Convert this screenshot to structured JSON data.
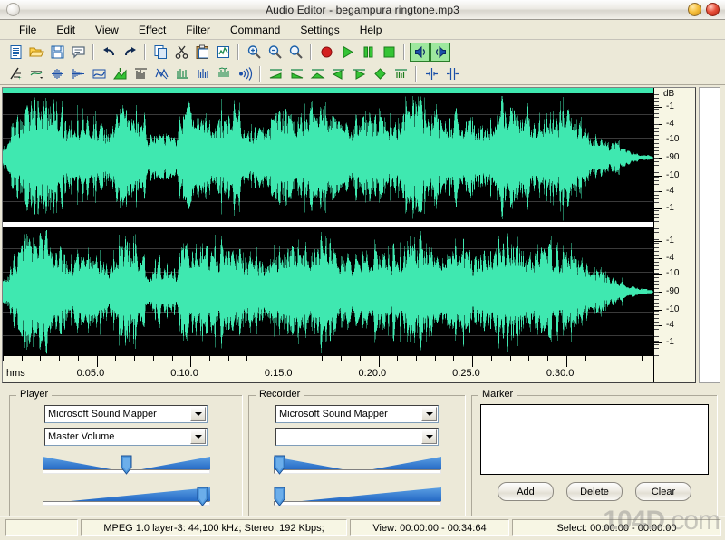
{
  "window": {
    "title": "Audio Editor - begampura ringtone.mp3",
    "buttons": {
      "minimize": "minimize-button",
      "close": "close-button"
    }
  },
  "menu": {
    "items": [
      "File",
      "Edit",
      "View",
      "Effect",
      "Filter",
      "Command",
      "Settings",
      "Help"
    ]
  },
  "toolbar": {
    "row1": [
      {
        "name": "new-file-icon",
        "title": "New"
      },
      {
        "name": "open-file-icon",
        "title": "Open"
      },
      {
        "name": "save-file-icon",
        "title": "Save"
      },
      {
        "name": "comment-icon",
        "title": "Properties"
      },
      {
        "sep": true
      },
      {
        "name": "undo-icon",
        "title": "Undo"
      },
      {
        "name": "redo-icon",
        "title": "Redo"
      },
      {
        "sep": true
      },
      {
        "name": "copy-icon",
        "title": "Copy"
      },
      {
        "name": "cut-icon",
        "title": "Cut"
      },
      {
        "name": "paste-icon",
        "title": "Paste"
      },
      {
        "name": "paste-special-icon",
        "title": "Paste Special"
      },
      {
        "sep": true
      },
      {
        "name": "zoom-in-icon",
        "title": "Zoom In"
      },
      {
        "name": "zoom-out-icon",
        "title": "Zoom Out"
      },
      {
        "name": "zoom-selection-icon",
        "title": "Zoom Selection"
      },
      {
        "sep": true
      },
      {
        "name": "record-icon",
        "title": "Record"
      },
      {
        "name": "play-icon",
        "title": "Play"
      },
      {
        "name": "pause-icon",
        "title": "Pause"
      },
      {
        "name": "stop-icon",
        "title": "Stop"
      },
      {
        "sep": true
      },
      {
        "name": "left-channel-icon",
        "title": "Left Channel"
      },
      {
        "name": "right-channel-icon",
        "title": "Right Channel"
      }
    ],
    "row2": [
      {
        "name": "amplify-icon",
        "title": "Amplify"
      },
      {
        "name": "normalize-icon",
        "title": "Normalize"
      },
      {
        "name": "fade-icon",
        "title": "Fade"
      },
      {
        "name": "envelope-icon",
        "title": "Envelope"
      },
      {
        "name": "equalizer-icon",
        "title": "Equalizer"
      },
      {
        "name": "compressor-icon",
        "title": "Compressor"
      },
      {
        "name": "spectrum-icon",
        "title": "Spectrum"
      },
      {
        "name": "noise-reduce-icon",
        "title": "Noise Reduction"
      },
      {
        "name": "echo-icon",
        "title": "Echo"
      },
      {
        "name": "reverb-icon",
        "title": "Reverb"
      },
      {
        "name": "chorus-icon",
        "title": "Chorus"
      },
      {
        "name": "delay-icon",
        "title": "Delay"
      },
      {
        "sep": true
      },
      {
        "name": "fade-in-icon",
        "title": "Fade In"
      },
      {
        "name": "fade-out-icon",
        "title": "Fade Out"
      },
      {
        "name": "crossfade-icon",
        "title": "Crossfade"
      },
      {
        "name": "reverse-left-icon",
        "title": "Reverse Left"
      },
      {
        "name": "reverse-right-icon",
        "title": "Reverse Right"
      },
      {
        "name": "invert-icon",
        "title": "Invert"
      },
      {
        "name": "trim-icon",
        "title": "Trim"
      },
      {
        "sep": true
      },
      {
        "name": "split-icon",
        "title": "Split"
      },
      {
        "name": "join-icon",
        "title": "Join"
      }
    ]
  },
  "waveform": {
    "background_color": "#000000",
    "wave_color": "#3fe8b0",
    "selection_bar_color": "#3fe8b0",
    "db_header": "dB",
    "db_labels": [
      "-1",
      "-4",
      "-10",
      "-90",
      "-10",
      "-4",
      "-1"
    ],
    "time_unit_label": "hms",
    "time_labels": [
      "0:05.0",
      "0:10.0",
      "0:15.0",
      "0:20.0",
      "0:25.0",
      "0:30.0"
    ],
    "channels": 2
  },
  "player": {
    "title": "Player",
    "device": "Microsoft Sound Mapper",
    "mixer_line": "Master Volume",
    "balance_value": 50,
    "volume_value": 100
  },
  "recorder": {
    "title": "Recorder",
    "device": "Microsoft Sound Mapper",
    "mixer_line": "",
    "balance_value": 0,
    "volume_value": 0
  },
  "marker": {
    "title": "Marker",
    "items": [],
    "add_label": "Add",
    "delete_label": "Delete",
    "clear_label": "Clear"
  },
  "status": {
    "cell1": "",
    "format": "MPEG 1.0 layer-3: 44,100 kHz; Stereo; 192 Kbps;",
    "view": "View: 00:00:00 - 00:34:64",
    "select": "Select: 00:00:00 - 00:00:00"
  },
  "watermark": {
    "brand": "104D",
    "suffix": ".com"
  }
}
